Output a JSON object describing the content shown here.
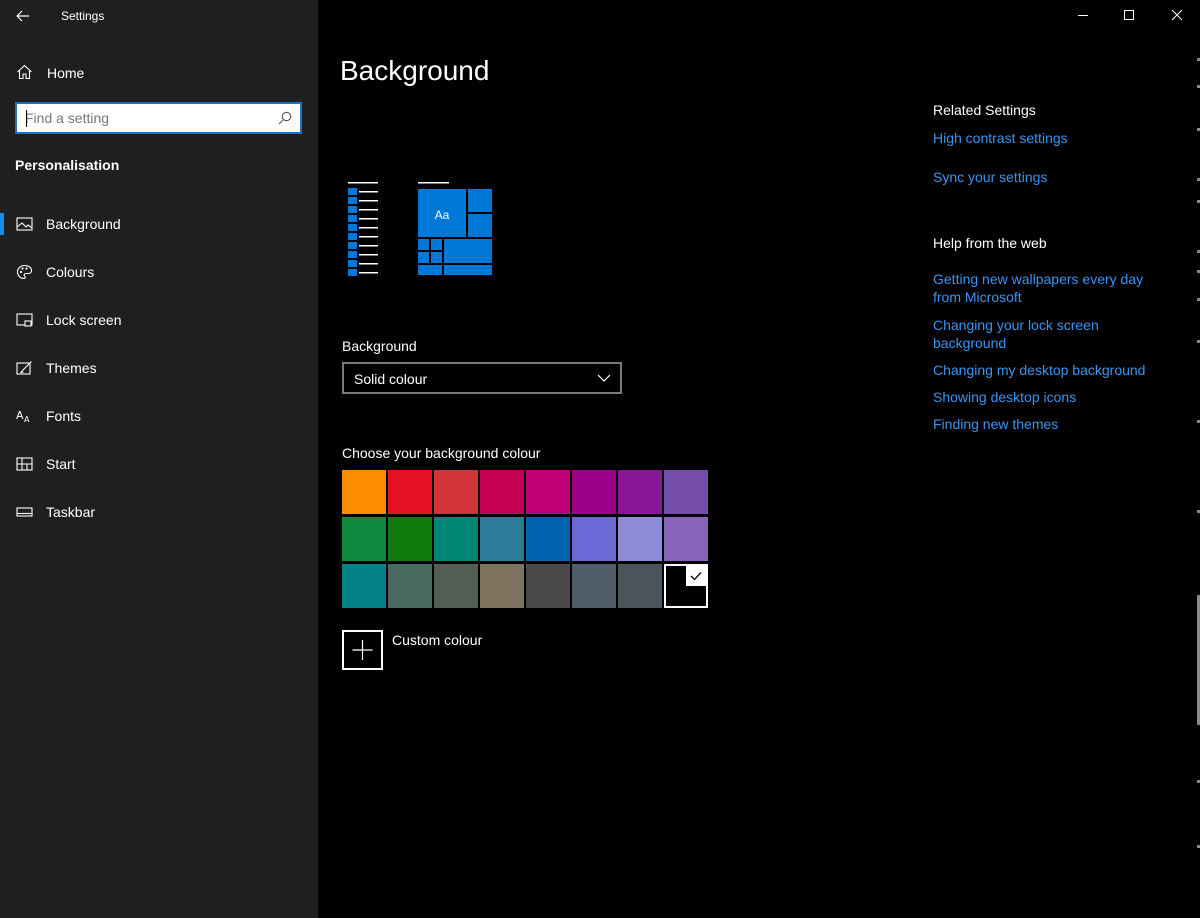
{
  "window": {
    "title": "Settings"
  },
  "sidebar": {
    "home_label": "Home",
    "search_placeholder": "Find a setting",
    "section_title": "Personalisation",
    "items": [
      {
        "label": "Background",
        "icon": "picture-icon",
        "active": true
      },
      {
        "label": "Colours",
        "icon": "palette-icon",
        "active": false
      },
      {
        "label": "Lock screen",
        "icon": "lock-screen-icon",
        "active": false
      },
      {
        "label": "Themes",
        "icon": "themes-icon",
        "active": false
      },
      {
        "label": "Fonts",
        "icon": "fonts-icon",
        "active": false
      },
      {
        "label": "Start",
        "icon": "start-icon",
        "active": false
      },
      {
        "label": "Taskbar",
        "icon": "taskbar-icon",
        "active": false
      }
    ]
  },
  "main": {
    "page_title": "Background",
    "preview": {
      "tile_text": "Aa",
      "accent": "#0078d7"
    },
    "background_label": "Background",
    "background_value": "Solid colour",
    "colour_label": "Choose your background colour",
    "colour_rows": [
      [
        "#ff8c00",
        "#e81123",
        "#d13438",
        "#c30052",
        "#bf0077",
        "#9a0089",
        "#881798",
        "#744da9"
      ],
      [
        "#10893e",
        "#107c10",
        "#018574",
        "#2d7d9a",
        "#0063b1",
        "#6b69d6",
        "#8e8cd8",
        "#8764b8"
      ],
      [
        "#038387",
        "#486860",
        "#525e54",
        "#7e735f",
        "#4c4a48",
        "#515c6b",
        "#4a5459",
        "#000000"
      ]
    ],
    "selected_colour": "#000000",
    "custom_colour_label": "Custom colour"
  },
  "related": {
    "title": "Related Settings",
    "links": [
      "High contrast settings",
      "Sync your settings"
    ]
  },
  "help": {
    "title": "Help from the web",
    "links": [
      "Getting new wallpapers every day from Microsoft",
      "Changing your lock screen background",
      "Changing my desktop background",
      "Showing desktop icons",
      "Finding new themes"
    ]
  },
  "colors": {
    "sidebar_bg": "#1f1f1f",
    "accent": "#1a8ce8",
    "link": "#3a95f0"
  }
}
